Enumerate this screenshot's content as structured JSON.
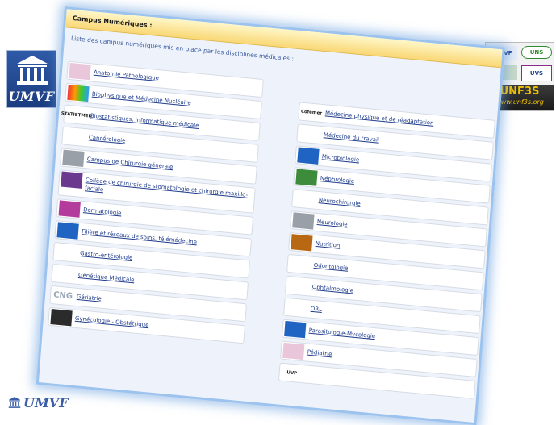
{
  "logos": {
    "left": {
      "text": "UMVF",
      "icon": "temple-icon"
    },
    "right": {
      "brand": "UNF3S",
      "url": "www.unf3s.org",
      "tile_labels": [
        "UMVF",
        "UNS",
        "",
        "UVS"
      ]
    },
    "bottom": {
      "text": "UMVF",
      "icon": "temple-icon"
    }
  },
  "screenshot": {
    "header_title": "Campus Numériques :",
    "subtitle": "Liste des campus numériques mis en place par les disciplines médicales :",
    "left_items": [
      {
        "label": "Anatomie Pathologique",
        "icon": "pink"
      },
      {
        "label": "Biophysique et Médecine Nucléaire",
        "icon": "rain"
      },
      {
        "label": "Biostatistiques, informatique médicale",
        "icon": "txt",
        "icon_text": "STATISTMED"
      },
      {
        "label": "Cancérologie",
        "icon": ""
      },
      {
        "label": "Campus de Chirurgie générale",
        "icon": "gray"
      },
      {
        "label": "Collège de chirurgie de stomatologie et chirurgie maxillo-faciale",
        "icon": "purple"
      },
      {
        "label": "Dermatologie",
        "icon": "magenta"
      },
      {
        "label": "Filière et réseaux de soins, télémédecine",
        "icon": "blueic"
      },
      {
        "label": "Gastro-entérologie",
        "icon": ""
      },
      {
        "label": "Génétique Médicale",
        "icon": ""
      },
      {
        "label": "Gériatrie",
        "icon": "cng",
        "icon_text": "CNG"
      },
      {
        "label": "Gynécologie - Obstétrique",
        "icon": "dark"
      }
    ],
    "right_items": [
      {
        "label": "Médecine physique et de réadaptation",
        "icon": "txt",
        "icon_text": "Cofemer"
      },
      {
        "label": "Médecine du travail",
        "icon": "txt",
        "icon_text": ""
      },
      {
        "label": "Microbiologie",
        "icon": "blueic"
      },
      {
        "label": "Néphrologie",
        "icon": "green"
      },
      {
        "label": "Neurochirurgie",
        "icon": "txt",
        "icon_text": ""
      },
      {
        "label": "Neurologie",
        "icon": "gray"
      },
      {
        "label": "Nutrition",
        "icon": "amber"
      },
      {
        "label": "Odontologie",
        "icon": ""
      },
      {
        "label": "Ophtalmologie",
        "icon": "eye"
      },
      {
        "label": "ORL",
        "icon": ""
      },
      {
        "label": "Parasitologie-Mycologie",
        "icon": "blueic"
      },
      {
        "label": "Pédiatrie",
        "icon": "pink"
      },
      {
        "label": "",
        "icon": "txt",
        "icon_text": "UVP"
      }
    ]
  }
}
